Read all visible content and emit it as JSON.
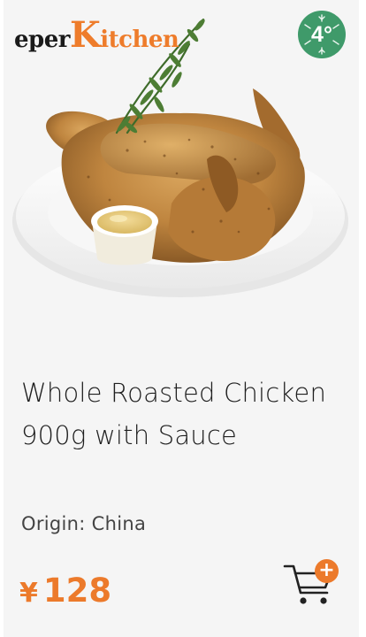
{
  "logo": {
    "part1": "epe",
    "part2": "r",
    "part3": "K",
    "part4": "itchen"
  },
  "temperature_badge": {
    "text": "4°",
    "color": "#3f9a6a",
    "icon": "snowflake-icon"
  },
  "product": {
    "image_alt": "roasted-chicken-photo",
    "title": "Whole Roasted Chicken 900g with Sauce",
    "origin": "Origin: China",
    "currency": "¥",
    "price": "128"
  },
  "cart": {
    "icon": "shopping-cart-icon",
    "badge": "+",
    "accent": "#ec7a2b"
  },
  "colors": {
    "accent": "#ec7a2b",
    "text": "#1f1f1f",
    "background": "#f5f5f5"
  }
}
